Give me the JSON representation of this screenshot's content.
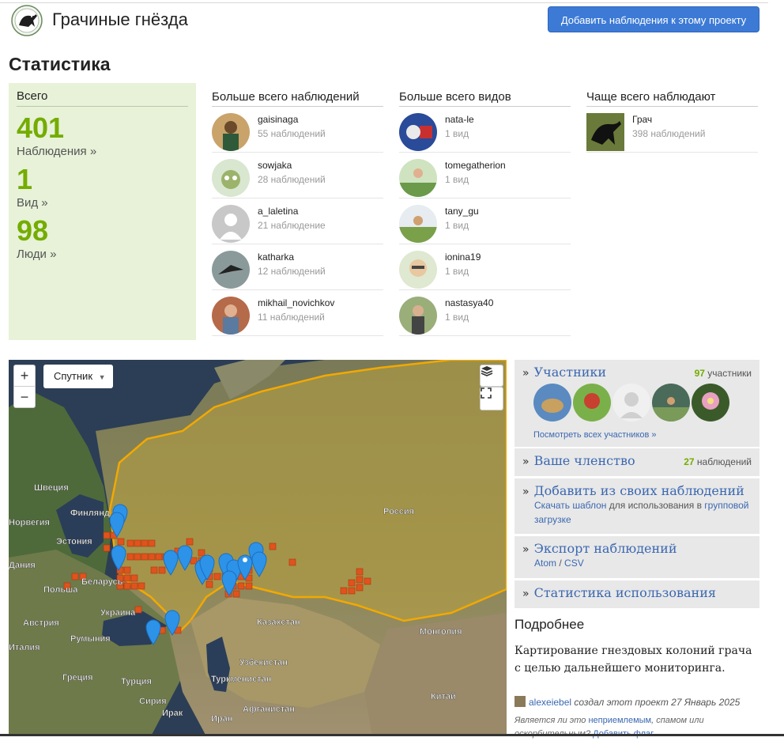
{
  "header": {
    "project_title": "Грачиные гнёзда",
    "add_button": "Добавить наблюдения к этому проекту"
  },
  "stats": {
    "heading": "Статистика",
    "totals": {
      "label": "Всего",
      "observations_count": "401",
      "observations_link": "Наблюдения »",
      "species_count": "1",
      "species_link": "Вид »",
      "people_count": "98",
      "people_link": "Люди »"
    },
    "top_observers": {
      "heading": "Больше всего наблюдений",
      "rows": [
        {
          "name": "gaisinaga",
          "count": "55 наблюдений"
        },
        {
          "name": "sowjaka",
          "count": "28 наблюдений"
        },
        {
          "name": "a_laletina",
          "count": "21 наблюдение"
        },
        {
          "name": "katharka",
          "count": "12 наблюдений"
        },
        {
          "name": "mikhail_novichkov",
          "count": "11 наблюдений"
        }
      ]
    },
    "top_species": {
      "heading": "Больше всего видов",
      "rows": [
        {
          "name": "nata-le",
          "count": "1 вид"
        },
        {
          "name": "tomegatherion",
          "count": "1 вид"
        },
        {
          "name": "tany_gu",
          "count": "1 вид"
        },
        {
          "name": "ionina19",
          "count": "1 вид"
        },
        {
          "name": "nastasya40",
          "count": "1 вид"
        }
      ]
    },
    "most_observed": {
      "heading": "Чаще всего наблюдают",
      "rows": [
        {
          "name": "Грач",
          "count": "398 наблюдений"
        }
      ]
    }
  },
  "map": {
    "zoom_in": "+",
    "zoom_out": "−",
    "map_type": "Спутник",
    "labels": {
      "sweden": "Швеция",
      "finland": "Финлянд",
      "norway": "Норвегия",
      "estonia": "Эстония",
      "denmark": "Дания",
      "belarus": "Беларусь",
      "poland": "Польша",
      "ukraine": "Украина",
      "austria": "Австрия",
      "romania": "Румыния",
      "italy": "Италия",
      "greece": "Греция",
      "turkey": "Турция",
      "syria": "Сирия",
      "iraq": "Ирак",
      "iran": "Иран",
      "russia": "Россия",
      "kazakhstan": "Казахстан",
      "uzbekistan": "Узбекистан",
      "turkmenistan": "Туркменистан",
      "afghanistan": "Афганистан",
      "mongolia": "Монголия",
      "china": "Китай"
    }
  },
  "sidebar": {
    "members": {
      "title": "Участники",
      "count_num": "97",
      "count_label": "участники",
      "see_all": "Посмотреть всех участников »"
    },
    "membership": {
      "title": "Ваше членство",
      "count_num": "27",
      "count_label": "наблюдений"
    },
    "add_from": {
      "title": "Добавить из своих наблюдений",
      "link1": "Скачать шаблон",
      "text": "для использования в",
      "link2": "групповой",
      "link3": "загрузке"
    },
    "export": {
      "title": "Экспорт наблюдений",
      "atom": "Atom",
      "slash": "/",
      "csv": "CSV"
    },
    "usage": {
      "title": "Статистика использования"
    },
    "more": {
      "heading": "Подробнее",
      "description": "Картирование гнездовых колоний грача с целью дальнейшего мониторинга.",
      "creator_name": "alexeiebel",
      "creator_text": "создал этот проект 27 Январь 2025",
      "report_text1": "Является ли это",
      "report_link1": "неприемлемым",
      "report_text2": ", спамом или оскорбительным?",
      "report_link2": "Добавить флаг"
    }
  },
  "colors": {
    "accent_green": "#74ac00",
    "link_blue": "#3b68b1",
    "button_blue": "#3c7ad6",
    "grid_orange": "#e0531c",
    "marker_blue": "#2d93e8",
    "border_gold": "#f2a900"
  }
}
